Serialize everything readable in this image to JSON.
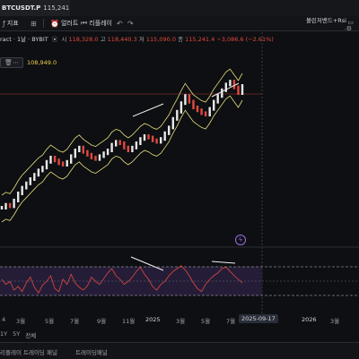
{
  "tab": {
    "symbol": "BTCUSDT.P",
    "price": "115,241.4",
    "status_dot": "-"
  },
  "toolbar": {
    "indicators": "지표",
    "alerts": "얼러트",
    "replay": "리플레이",
    "rsi_indicator": "볼린저밴드+Rsi",
    "rsi_indicator_sub": "."
  },
  "legend": {
    "title": "ract · 1날 · BYBIT",
    "open_label": "시",
    "open": "118,328.0",
    "high_label": "고",
    "high": "118,440.3",
    "low_label": "저",
    "low": "115,090.0",
    "close_label": "종",
    "close": "115,241.4",
    "change": "−3,086.6 (−2.61%)",
    "indicator_value": "108,949.0"
  },
  "xaxis": {
    "ticks": [
      "4",
      "3월",
      "5월",
      "7월",
      "9월",
      "11월",
      "2025",
      "3월",
      "5월",
      "7월",
      "2026",
      "3월"
    ],
    "date_badge": "2025-09-17"
  },
  "ranges": [
    "1Y",
    "5Y",
    "전체"
  ],
  "bottom": {
    "item1": "리플레이 트레이딩 패널",
    "item2": "트레이딩패널"
  },
  "colors": {
    "up": "#e8e8e8",
    "down": "#e1493f",
    "band": "#e6e07a",
    "rsi": "#e1493f",
    "rsi_band": "#2a2340",
    "accent": "#a06ae8"
  },
  "chart_data": {
    "type": "line",
    "price_series": [
      30,
      32,
      31,
      35,
      40,
      44,
      47,
      50,
      53,
      56,
      58,
      62,
      65,
      63,
      61,
      60,
      62,
      66,
      70,
      72,
      69,
      67,
      65,
      64,
      66,
      68,
      70,
      74,
      76,
      75,
      72,
      70,
      72,
      75,
      78,
      80,
      79,
      77,
      76,
      78,
      82,
      86,
      92,
      97,
      103,
      108,
      104,
      100,
      98,
      96,
      95,
      99,
      104,
      108,
      112,
      116,
      118,
      114,
      110,
      115
    ],
    "rsi_series": [
      55,
      48,
      52,
      40,
      45,
      38,
      50,
      58,
      44,
      36,
      47,
      52,
      60,
      42,
      38,
      55,
      48,
      62,
      50,
      44,
      40,
      46,
      58,
      52,
      48,
      56,
      64,
      70,
      60,
      55,
      48,
      52,
      58,
      66,
      72,
      62,
      55,
      45,
      40,
      48,
      52,
      60,
      66,
      70,
      74,
      68,
      60,
      50,
      42,
      38,
      48,
      55,
      60,
      64,
      70,
      72,
      66,
      60,
      55,
      50
    ]
  }
}
